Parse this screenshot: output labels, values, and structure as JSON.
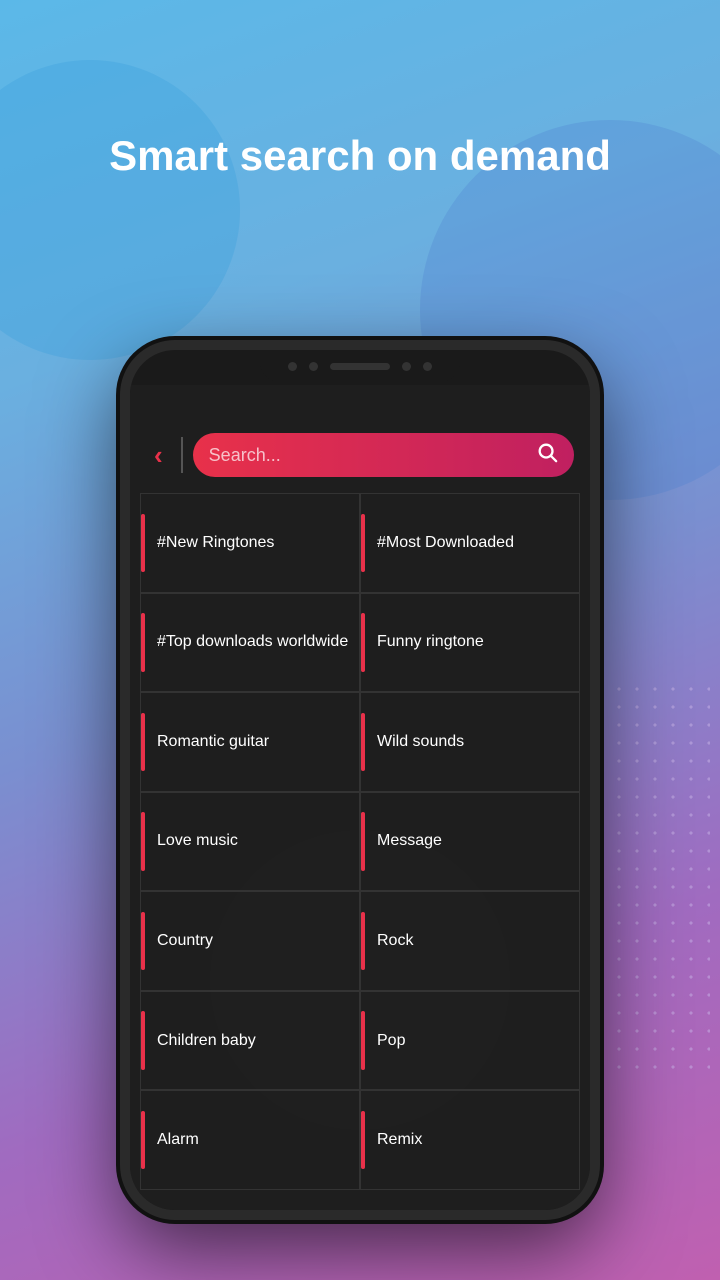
{
  "headline": "Smart search on demand",
  "search": {
    "placeholder": "Search...",
    "back_label": "<"
  },
  "categories": [
    {
      "id": "new-ringtones",
      "label": "#New Ringtones",
      "col": 0,
      "row": 0
    },
    {
      "id": "most-downloaded",
      "label": "#Most Downloaded",
      "col": 1,
      "row": 0
    },
    {
      "id": "top-downloads",
      "label": "#Top downloads worldwide",
      "col": 0,
      "row": 1
    },
    {
      "id": "funny-ringtone",
      "label": "Funny ringtone",
      "col": 1,
      "row": 1
    },
    {
      "id": "romantic-guitar",
      "label": "Romantic guitar",
      "col": 0,
      "row": 2
    },
    {
      "id": "wild-sounds",
      "label": "Wild sounds",
      "col": 1,
      "row": 2
    },
    {
      "id": "love-music",
      "label": "Love music",
      "col": 0,
      "row": 3
    },
    {
      "id": "message",
      "label": "Message",
      "col": 1,
      "row": 3
    },
    {
      "id": "country",
      "label": "Country",
      "col": 0,
      "row": 4
    },
    {
      "id": "rock",
      "label": "Rock",
      "col": 1,
      "row": 4
    },
    {
      "id": "children-baby",
      "label": "Children baby",
      "col": 0,
      "row": 5
    },
    {
      "id": "pop",
      "label": "Pop",
      "col": 1,
      "row": 5
    },
    {
      "id": "alarm",
      "label": "Alarm",
      "col": 0,
      "row": 6
    },
    {
      "id": "remix",
      "label": "Remix",
      "col": 1,
      "row": 6
    }
  ],
  "colors": {
    "accent": "#e8314a",
    "bg_dark": "#1e1e1e",
    "text_white": "#ffffff"
  }
}
